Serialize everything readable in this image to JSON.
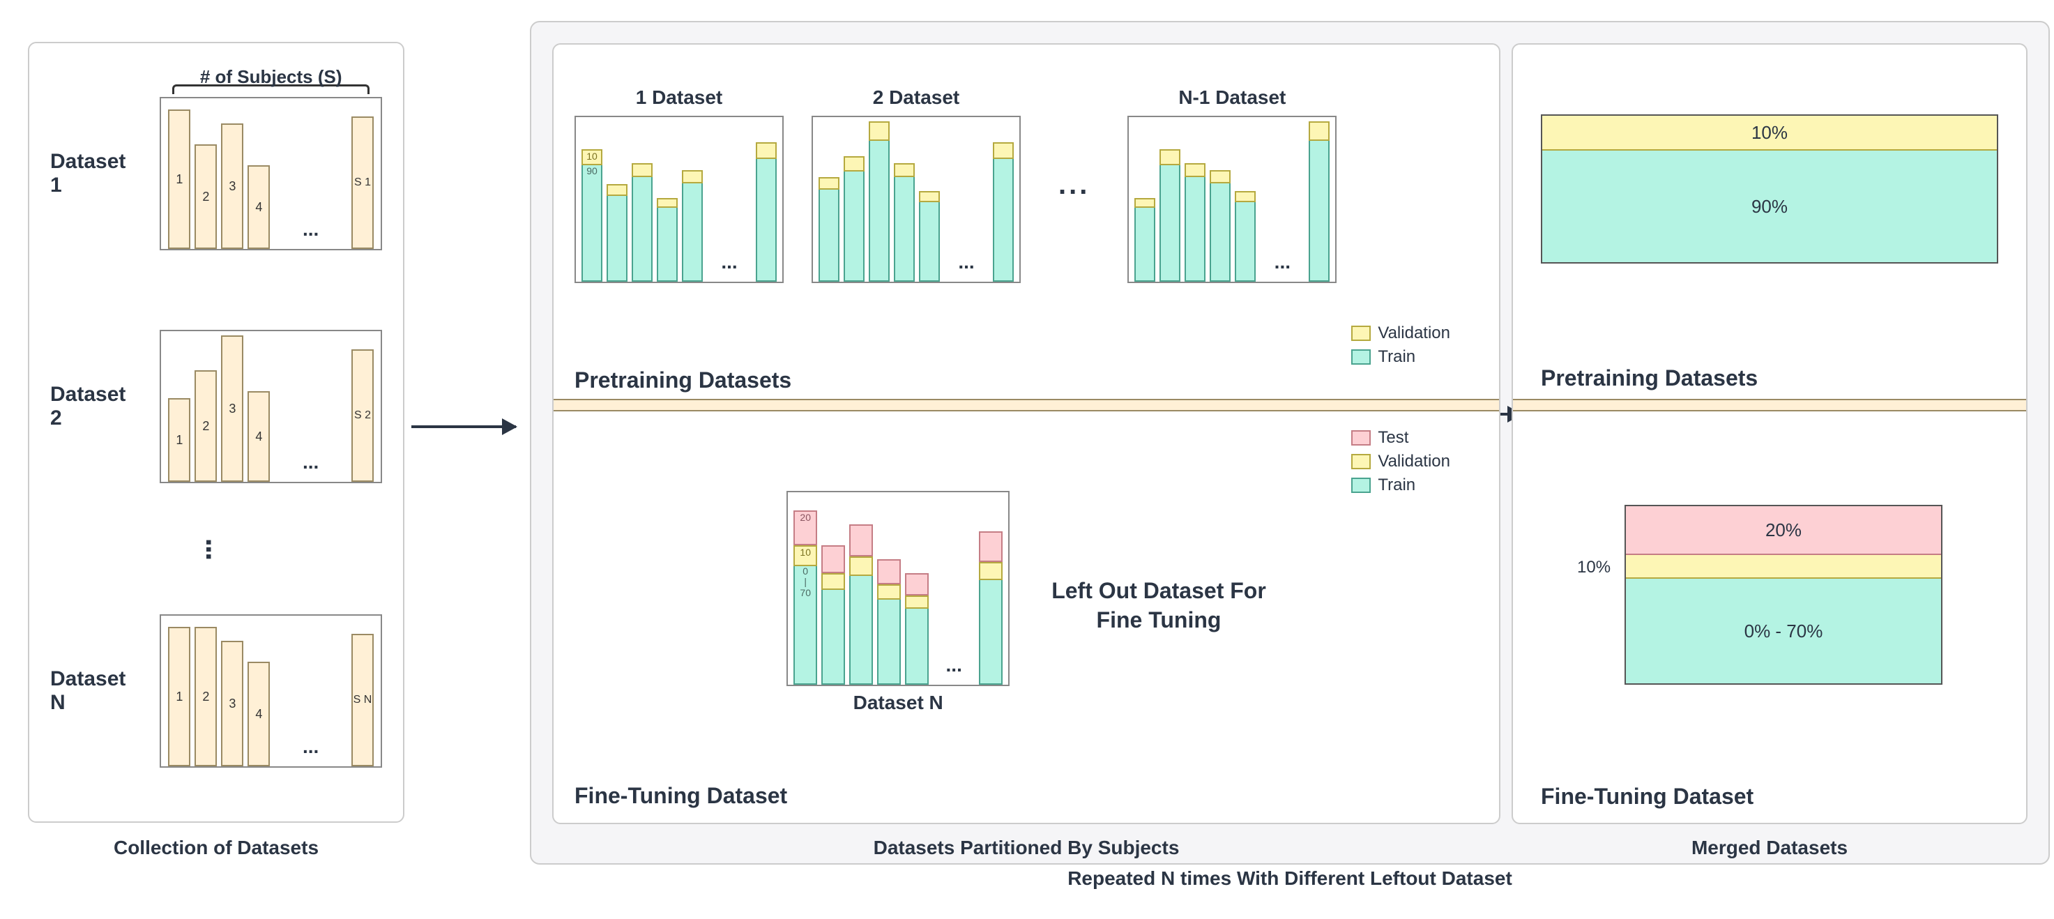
{
  "panel1": {
    "caption": "Collection of Datasets",
    "braceLabel": "# of Subjects (S)",
    "datasets": [
      {
        "label": "Dataset\n1",
        "last": "S 1",
        "bars": [
          200,
          150,
          180,
          120
        ]
      },
      {
        "label": "Dataset\n2",
        "last": "S 2",
        "bars": [
          120,
          160,
          210,
          130
        ]
      },
      {
        "label": "Dataset\nN",
        "last": "S N",
        "bars": [
          200,
          200,
          180,
          150
        ]
      }
    ],
    "barIdx": [
      "1",
      "2",
      "3",
      "4"
    ]
  },
  "panel2": {
    "caption": "Datasets Partitioned By Subjects",
    "pretrainLabel": "Pretraining Datasets",
    "finetuneLabel": "Fine-Tuning Dataset",
    "smallTitles": [
      "1 Dataset",
      "2 Dataset",
      "N-1 Dataset"
    ],
    "ellipsis": "...",
    "valPct": "10",
    "trainPct": "90",
    "legendPretrain": [
      "Validation",
      "Train"
    ],
    "legendFinetune": [
      "Test",
      "Validation",
      "Train"
    ],
    "ftChartTitle": "Dataset N",
    "ftTestPct": "20",
    "ftValPct": "10",
    "ftTrainPct": "0\n|\n70",
    "ftText": "Left Out Dataset For\nFine Tuning"
  },
  "panel3": {
    "caption": "Merged Datasets",
    "pretrainLabel": "Pretraining Datasets",
    "finetuneLabel": "Fine-Tuning Dataset",
    "topVal": "10%",
    "topTrain": "90%",
    "botTest": "20%",
    "botValSide": "10%",
    "botTrain": "0% - 70%"
  },
  "repeatCaption": "Repeated N times With Different Leftout Dataset",
  "chart_data": {
    "type": "diagram",
    "description": "Leave-one-dataset-out pretraining/finetuning split scheme",
    "collection": {
      "datasets": "N",
      "subjects_axis": "# of Subjects (S)"
    },
    "pretraining_split": {
      "validation_pct": 10,
      "train_pct": 90,
      "datasets_used": "N-1"
    },
    "finetuning_split": {
      "test_pct": 20,
      "validation_pct": 10,
      "train_pct_range": [
        0,
        70
      ],
      "dataset_used": "left-out dataset"
    },
    "repeat": "N times with different left-out dataset"
  }
}
